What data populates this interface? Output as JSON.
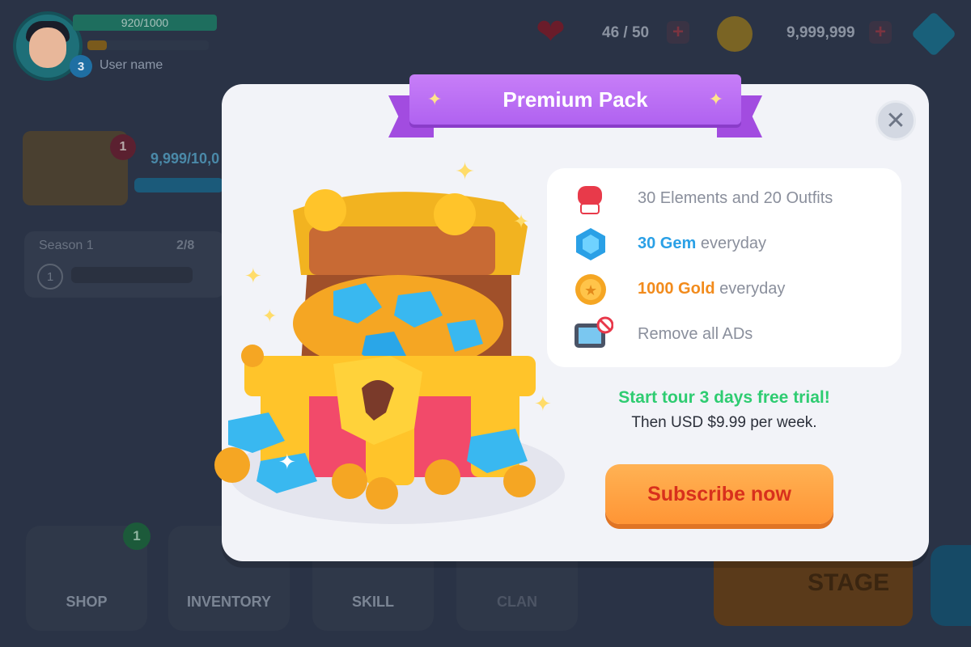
{
  "hud": {
    "xp": "920/1000",
    "level": "3",
    "username": "User name",
    "lives": "46 / 50",
    "coins": "9,999,999",
    "chest_badge": "1",
    "chest_count": "9,999/10,0",
    "season_label": "Season 1",
    "season_count": "2/8",
    "season_level": "1"
  },
  "nav": {
    "shop": "SHOP",
    "shop_badge": "1",
    "inventory": "INVENTORY",
    "skill": "SKILL",
    "clan": "CLAN",
    "stage": "STAGE"
  },
  "modal": {
    "title": "Premium Pack",
    "close_icon": "x-icon",
    "features": {
      "outfits": "30 Elements and 20 Outfits",
      "gem_value": "30 Gem",
      "gem_suffix": " everyday",
      "gold_value": "1000 Gold",
      "gold_suffix": " everyday",
      "ads": "Remove all ADs"
    },
    "trial": "Start tour 3 days free trial!",
    "price": "Then USD $9.99 per week.",
    "subscribe": "Subscribe now"
  },
  "colors": {
    "ribbon": "#b062f0",
    "trial_green": "#2ecc71",
    "gem_blue": "#2aa0e6",
    "gold_orange": "#f28b1c",
    "button_orange": "#ff9535"
  }
}
